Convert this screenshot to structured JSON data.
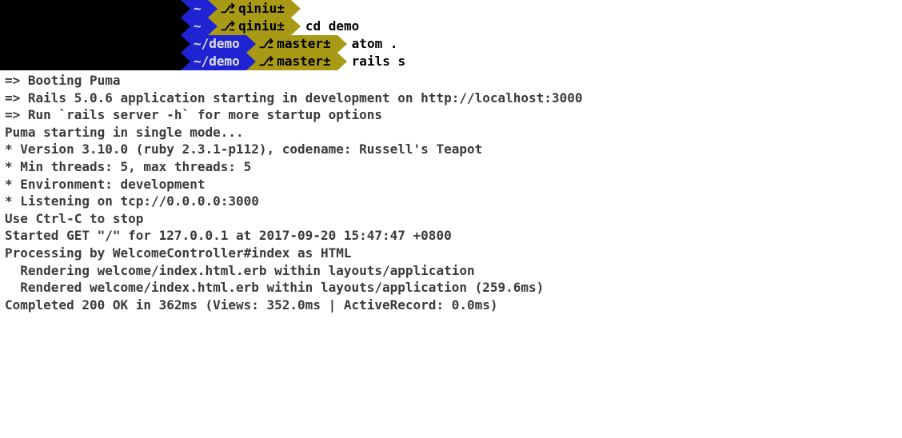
{
  "prompts": {
    "p1": {
      "path": "~",
      "branch": "qiniu±",
      "cmd": ""
    },
    "p2": {
      "path": "~",
      "branch": "qiniu±",
      "cmd": "cd demo"
    },
    "p3": {
      "path": "~/demo",
      "branch": "master±",
      "cmd": "atom ."
    },
    "p4": {
      "path": "~/demo",
      "branch": "master±",
      "cmd": "rails s"
    }
  },
  "output": {
    "l01": "=> Booting Puma",
    "l02": "=> Rails 5.0.6 application starting in development on http://localhost:3000",
    "l03": "=> Run `rails server -h` for more startup options",
    "l04": "Puma starting in single mode...",
    "l05": "* Version 3.10.0 (ruby 2.3.1-p112), codename: Russell's Teapot",
    "l06": "* Min threads: 5, max threads: 5",
    "l07": "* Environment: development",
    "l08": "* Listening on tcp://0.0.0.0:3000",
    "l09": "Use Ctrl-C to stop",
    "l10": "Started GET \"/\" for 127.0.0.1 at 2017-09-20 15:47:47 +0800",
    "l11": "Processing by WelcomeController#index as HTML",
    "l12": "  Rendering welcome/index.html.erb within layouts/application",
    "l13": "  Rendered welcome/index.html.erb within layouts/application (259.6ms)",
    "l14": "Completed 200 OK in 362ms (Views: 352.0ms | ActiveRecord: 0.0ms)"
  },
  "icons": {
    "git_branch": "⎇"
  }
}
